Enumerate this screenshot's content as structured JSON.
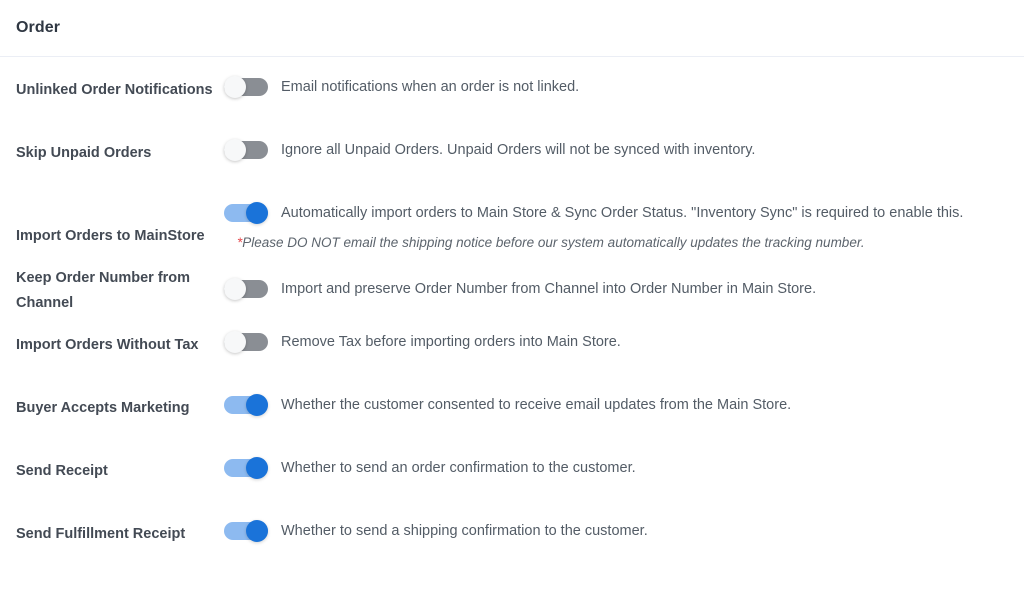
{
  "header": {
    "title": "Order"
  },
  "colors": {
    "toggle_on_knob": "#1a73d9",
    "toggle_on_track": "#8dbaf0",
    "toggle_off_track": "#8a8e94",
    "toggle_off_knob": "#f7f8f9",
    "note_asterisk": "#e5484d",
    "label_text": "#434a54",
    "description_text": "#535c66",
    "divider": "#ebeef5"
  },
  "settings": [
    {
      "label": "Unlinked Order Notifications",
      "toggle_state": "off",
      "description": "Email notifications when an order is not linked.",
      "note": null,
      "note_asterisk": null
    },
    {
      "label": "Skip Unpaid Orders",
      "toggle_state": "off",
      "description": "Ignore all Unpaid Orders. Unpaid Orders will not be synced with inventory.",
      "note": null,
      "note_asterisk": null
    },
    {
      "label": "Import Orders to MainStore",
      "toggle_state": "on",
      "description": "Automatically import orders to Main Store & Sync Order Status. \"Inventory Sync\" is required to enable this.",
      "note": "Please DO NOT email the shipping notice before our system automatically updates the tracking number.",
      "note_asterisk": "*"
    },
    {
      "label": "Keep Order Number from Channel",
      "toggle_state": "off",
      "description": "Import and preserve Order Number from Channel into Order Number in Main Store.",
      "note": null,
      "note_asterisk": null
    },
    {
      "label": "Import Orders Without Tax",
      "toggle_state": "off",
      "description": "Remove Tax before importing orders into Main Store.",
      "note": null,
      "note_asterisk": null
    },
    {
      "label": "Buyer Accepts Marketing",
      "toggle_state": "on",
      "description": "Whether the customer consented to receive email updates from the Main Store.",
      "note": null,
      "note_asterisk": null
    },
    {
      "label": "Send Receipt",
      "toggle_state": "on",
      "description": "Whether to send an order confirmation to the customer.",
      "note": null,
      "note_asterisk": null
    },
    {
      "label": "Send Fulfillment Receipt",
      "toggle_state": "on",
      "description": "Whether to send a shipping confirmation to the customer.",
      "note": null,
      "note_asterisk": null
    }
  ]
}
